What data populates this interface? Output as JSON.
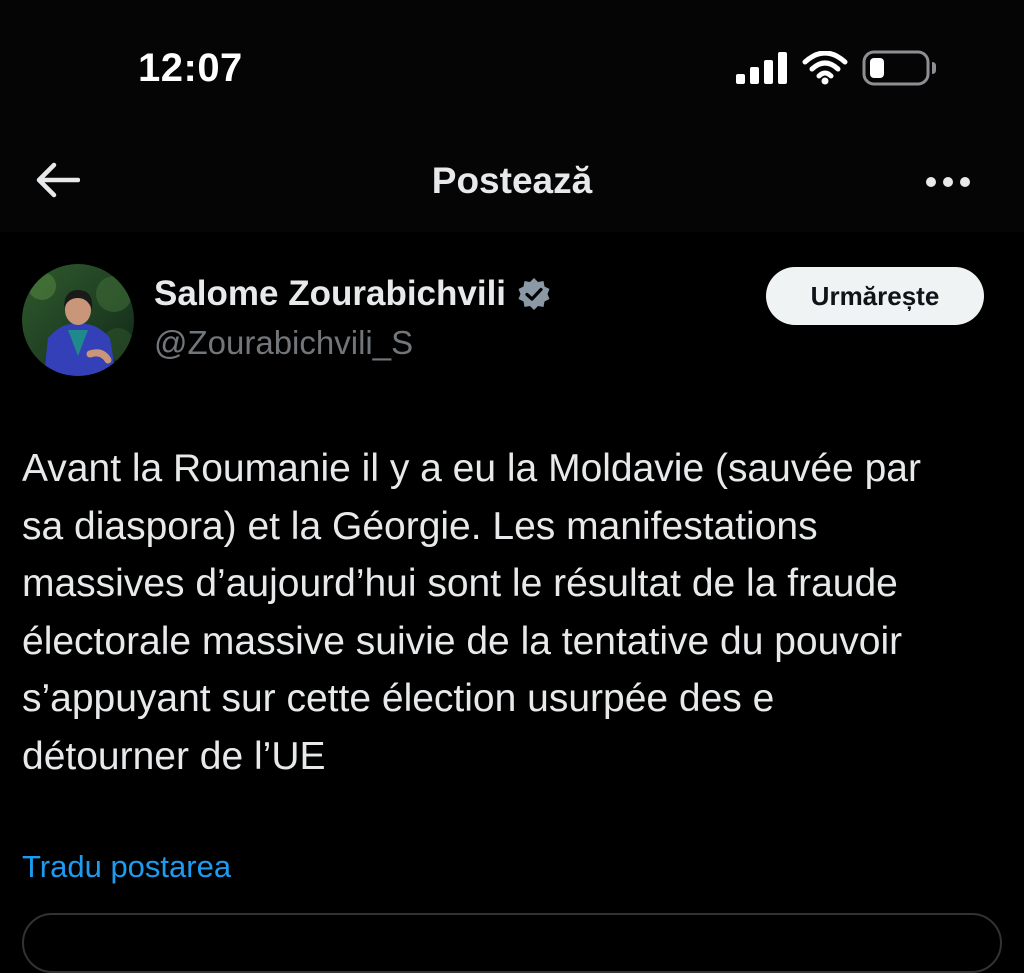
{
  "status_bar": {
    "time": "12:07",
    "icons": [
      "signal-icon",
      "wifi-icon",
      "battery-icon"
    ]
  },
  "nav": {
    "title": "Postează",
    "back_icon": "arrow-left-icon",
    "more_icon": "more-horizontal-icon"
  },
  "post": {
    "author": {
      "display_name": "Salome Zourabichvili",
      "handle": "@Zourabichvili_S",
      "verified_icon": "verified-badge-icon"
    },
    "follow_label": "Urmărește",
    "text": "Avant la Roumanie il y a eu la Moldavie (sauvée par\nsa diaspora) et la Géorgie. Les manifestations\nmassives d’aujourd’hui sont le résultat de la fraude\nélectorale massive suivie de la tentative du pouvoir\ns’appuyant sur cette élection usurpée des e\ndétourner de l’UE",
    "translate_label": "Tradu postarea"
  },
  "colors": {
    "background": "#000000",
    "text_primary": "#e7e9ea",
    "text_secondary": "#71767b",
    "accent_blue": "#1d9bf0",
    "follow_button_bg": "#eff3f4",
    "verified_badge": "#8b98a5"
  }
}
